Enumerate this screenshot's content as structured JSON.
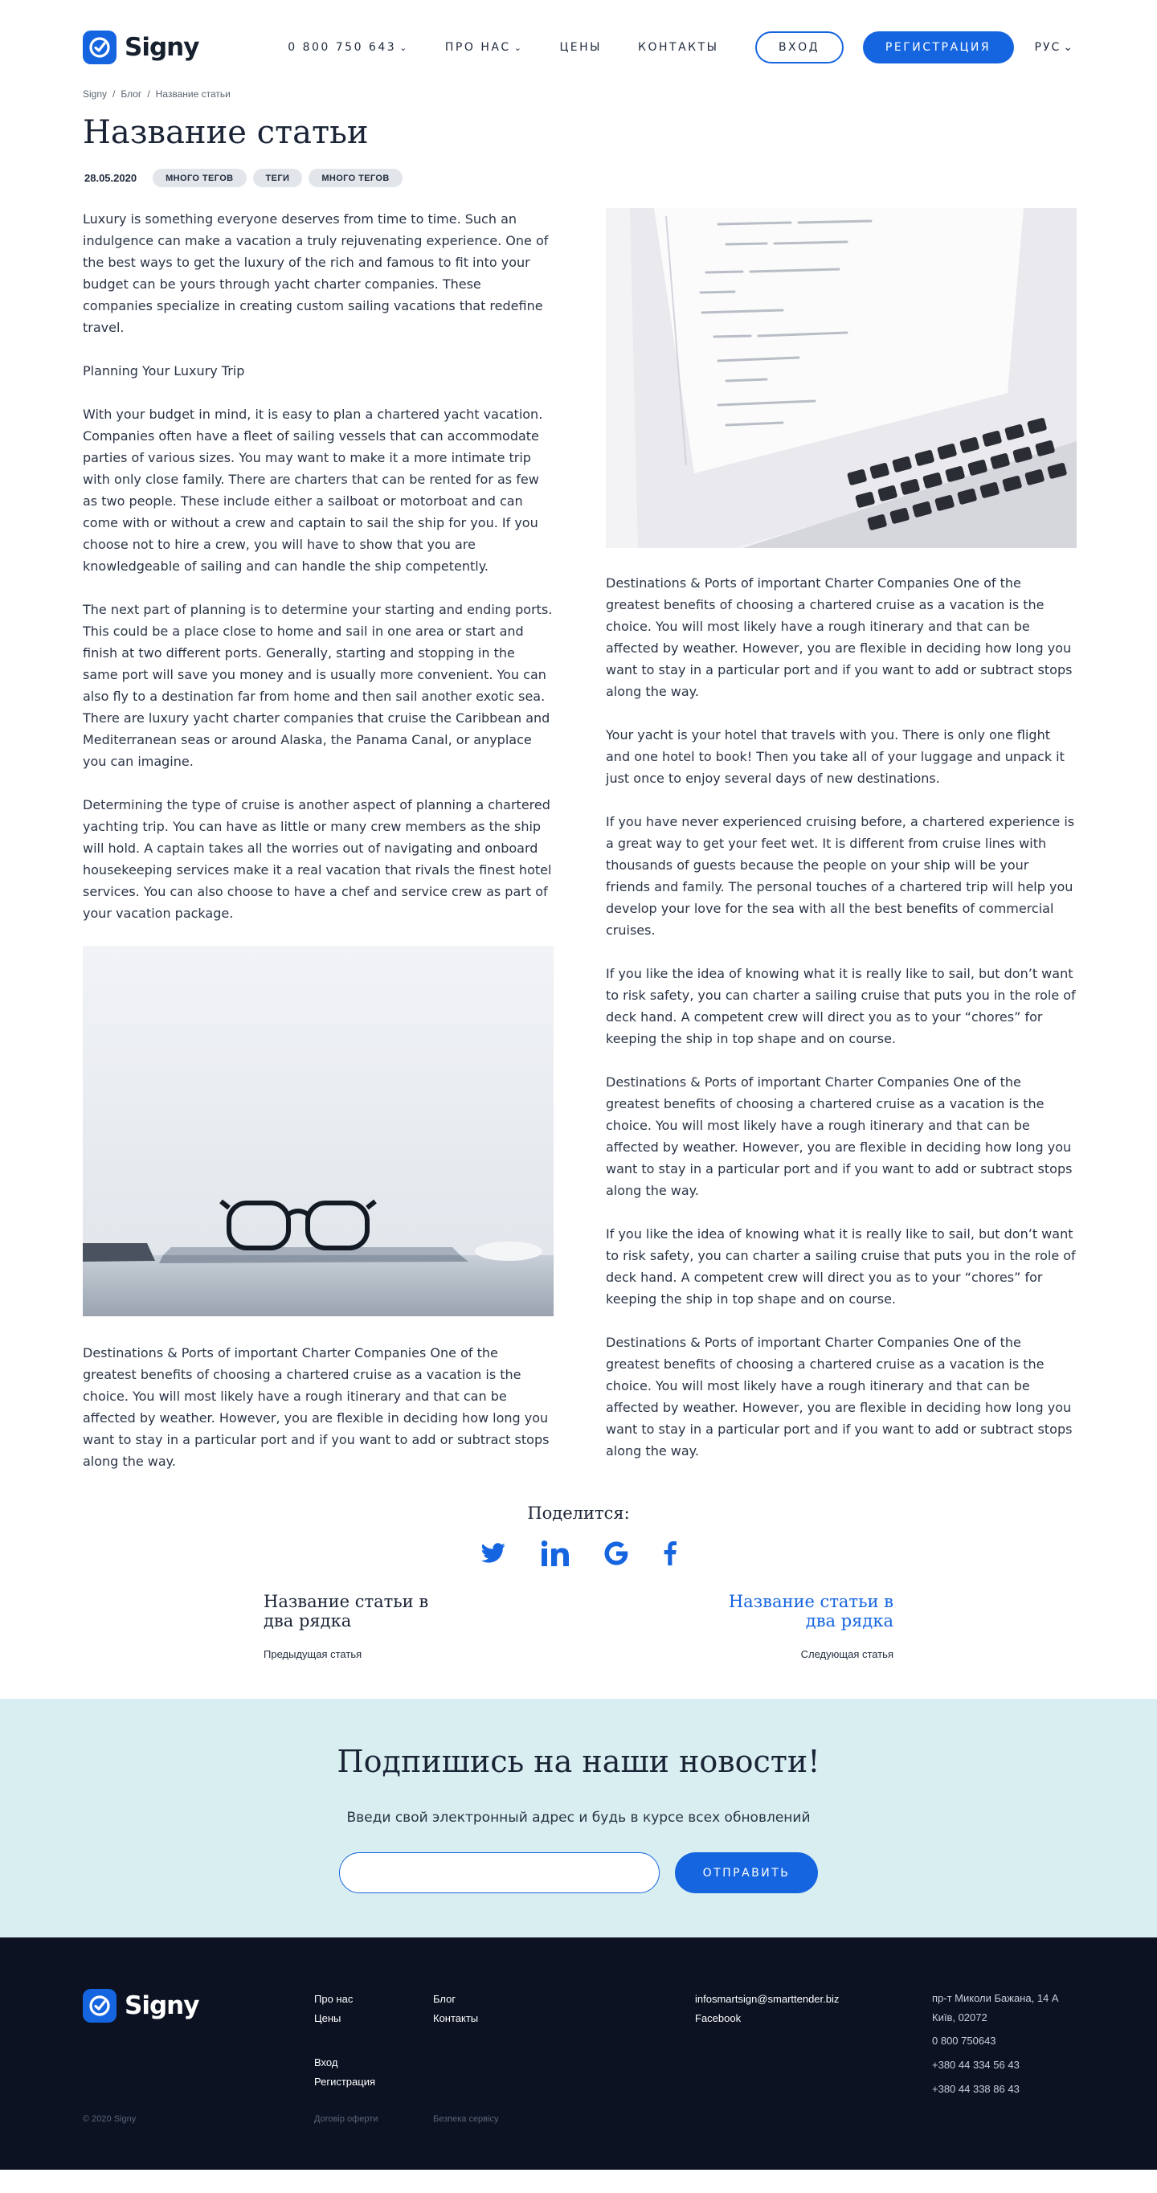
{
  "header": {
    "logo_text": "Signy",
    "phone": "0 800 750 643",
    "nav_about": "ПРО НАС",
    "nav_prices": "ЦЕНЫ",
    "nav_contacts": "КОНТАКТЫ",
    "login": "ВХОД",
    "register": "РЕГИСТРАЦИЯ",
    "lang": "РУС"
  },
  "breadcrumbs": [
    "Signy",
    "Блог",
    "Название статьи"
  ],
  "article": {
    "title": "Название статьи",
    "date": "28.05.2020",
    "tags": [
      "МНОГО ТЕГОВ",
      "ТЕГИ",
      "МНОГО ТЕГОВ"
    ],
    "left_paragraphs": [
      "Luxury is something everyone deserves from time to time. Such an indulgence can make a vacation a truly rejuvenating experience. One of the best ways to get the luxury of the rich and famous to fit into your budget can be yours through yacht charter companies. These companies specialize in creating custom sailing vacations that redefine travel.",
      "Planning Your Luxury Trip",
      "With your budget in mind, it is easy to plan a chartered yacht vacation. Companies often have a fleet of sailing vessels that can accommodate parties of various sizes. You may want to make it a more intimate trip with only close family. There are charters that can be rented for as few as two people. These include either a sailboat or motorboat and can come with or without a crew and captain to sail the ship for you. If you choose not to hire a crew, you will have to show that you are knowledgeable of sailing and can handle the ship competently.",
      "The next part of planning is to determine your starting and ending ports. This could be a place close to home and sail in one area or start and finish at two different ports. Generally, starting and stopping in the same port will save you money and is usually more convenient. You can also fly to a destination far from home and then sail another exotic sea. There are luxury yacht charter companies that cruise the Caribbean and Mediterranean seas or around Alaska, the Panama Canal, or anyplace you can imagine.",
      "Determining the type of cruise is another aspect of planning a chartered yachting trip. You can have as little or many crew members as the ship will hold. A captain takes all the worries out of navigating and onboard housekeeping services make it a real vacation that rivals the finest hotel services. You can also choose to have a chef and service crew as part of your vacation package."
    ],
    "left_after_image": "Destinations & Ports of important Charter Companies  One of the greatest benefits of choosing a chartered cruise as a vacation is the choice. You will most likely have a rough itinerary and that can be affected by weather. However, you are flexible in deciding how long you want to stay in a particular port and if you want to add or subtract stops along the way.",
    "right_paragraphs": [
      "Destinations & Ports of important Charter Companies  One of the greatest benefits of choosing a chartered cruise as a vacation is the choice. You will most likely have a rough itinerary and that can be affected by weather. However, you are flexible in deciding how long you want to stay in a particular port and if you want to add or subtract stops along the way.",
      "Your yacht is your hotel that travels with you. There is only one flight and one hotel to book! Then you take all of your luggage and unpack it just once to enjoy several days of new destinations.",
      "If you have never experienced cruising before, a chartered experience is a great way to get your feet wet. It is different from cruise lines with thousands of guests because the people on your ship will be your friends and family. The personal touches of a chartered trip will help you develop your love for the sea with all the best benefits of commercial cruises.",
      "If you like the idea of knowing what it is really like to sail, but don’t want to risk safety, you can charter a sailing cruise that puts you in the role of deck hand. A competent crew will direct you as to your “chores” for keeping the ship in top shape and on course.",
      "Destinations & Ports of important Charter Companies  One of the greatest benefits of choosing a chartered cruise as a vacation is the choice. You will most likely have a rough itinerary and that can be affected by weather. However, you are flexible in deciding how long you want to stay in a particular port and if you want to add or subtract stops along the way.",
      "If you like the idea of knowing what it is really like to sail, but don’t want to risk safety, you can charter a sailing cruise that puts you in the role of deck hand. A competent crew will direct you as to your “chores” for keeping the ship in top shape and on course.",
      "Destinations & Ports of important Charter Companies  One of the greatest benefits of choosing a chartered cruise as a vacation is the choice. You will most likely have a rough itinerary and that can be affected by weather. However, you are flexible in deciding how long you want to stay in a particular port and if you want to add or subtract stops along the way."
    ]
  },
  "share": {
    "title": "Поделится:",
    "icons": [
      "twitter-icon",
      "linkedin-icon",
      "google-icon",
      "facebook-icon"
    ]
  },
  "post_nav": {
    "prev_title": "Название статьи в два рядка",
    "prev_label": "Предыдущая статья",
    "next_title": "Название статьи в два рядка",
    "next_label": "Следующая статья"
  },
  "subscribe": {
    "title": "Подпишись на наши новости!",
    "text": "Введи свой электронный адрес и будь в курсе всех обновлений",
    "button": "ОТПРАВИТЬ",
    "email_value": ""
  },
  "footer": {
    "logo_text": "Signy",
    "about": "Про нас",
    "prices": "Цены",
    "blog": "Блог",
    "contacts": "Контакты",
    "login": "Вход",
    "register": "Регистрация",
    "email": "infosmartsign@smarttender.biz",
    "facebook": "Facebook",
    "address_line1": "пр-т Миколи Бажана, 14 А",
    "address_line2": "Київ, 02072",
    "phone1": "0 800 750643",
    "phone2": "+380 44 334 56 43",
    "phone3": "+380 44 338 86 43",
    "copyright": "© 2020 Signy",
    "offer": "Договір оферти",
    "security": "Безпека сервісу"
  },
  "colors": {
    "accent": "#1565e0",
    "subscribe_bg": "#d9eef0",
    "footer_bg": "#0c1222"
  }
}
